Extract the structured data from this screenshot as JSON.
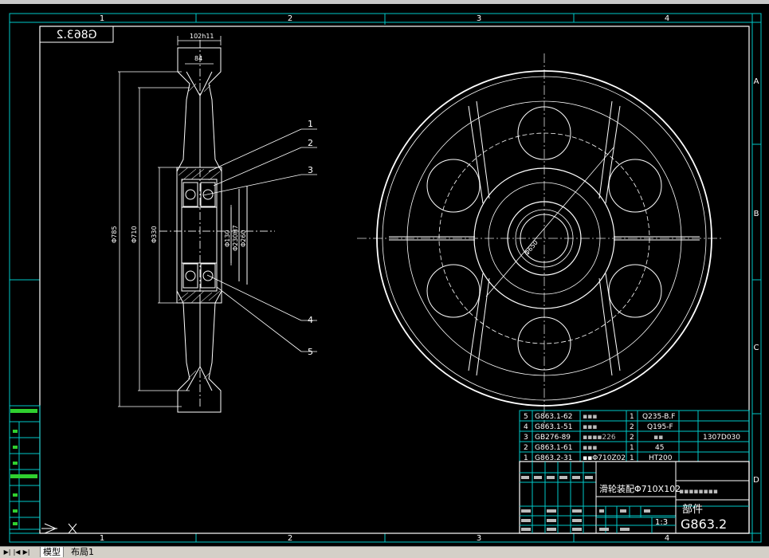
{
  "frame": {
    "columns": [
      "1",
      "2",
      "3",
      "4"
    ],
    "rows": [
      "A",
      "B",
      "C",
      "D"
    ]
  },
  "drawing_code_mirrored": "G863.2",
  "dims": {
    "total_width": "102h11",
    "groove_width": "84",
    "d1": "Φ785",
    "d2": "Φ710",
    "d3": "Φ330",
    "d4": "Φ130",
    "d5": "Φ230H7",
    "d6": "Φ260",
    "bore": "Φ650"
  },
  "balloons": [
    "1",
    "2",
    "3",
    "4",
    "5"
  ],
  "bom": [
    {
      "no": "5",
      "code": "G863.1-62",
      "name": "▪▪▪",
      "qty": "1",
      "material": "Q235-B.F",
      "note": ""
    },
    {
      "no": "4",
      "code": "G863.1-51",
      "name": "▪▪▪",
      "qty": "2",
      "material": "Q195-F",
      "note": ""
    },
    {
      "no": "3",
      "code": "GB276-89",
      "name": "▪▪▪▪226",
      "qty": "2",
      "material": "▪▪",
      "note": "1307D030"
    },
    {
      "no": "2",
      "code": "G863.1-61",
      "name": "▪▪▪",
      "qty": "1",
      "material": "45",
      "note": ""
    },
    {
      "no": "1",
      "code": "G863.2-31",
      "name": "▪▪Φ710Z02",
      "qty": "1",
      "material": "HT200",
      "note": ""
    }
  ],
  "title_block": {
    "assembly_name": "滑轮装配Φ710X102",
    "company": "▪▪▪▪▪▪▪▪",
    "parts_label": "部件",
    "scale": "1:3",
    "drawing_no": "G863.2"
  },
  "status_bar": {
    "tabs": [
      "模型",
      "布局1"
    ],
    "active_tab": "模型"
  }
}
